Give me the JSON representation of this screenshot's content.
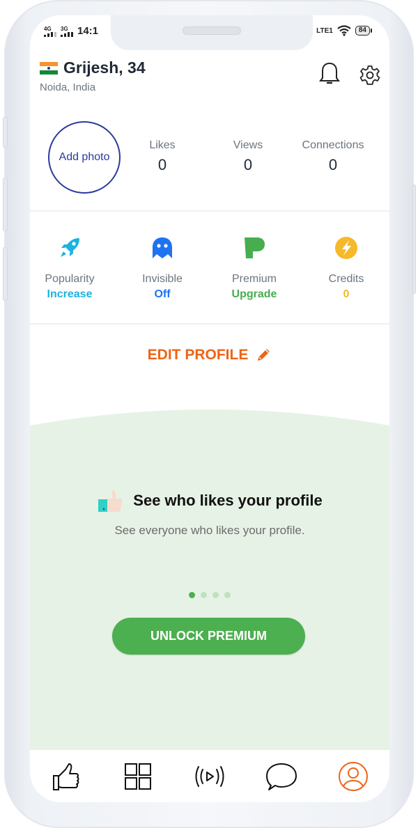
{
  "status_bar": {
    "network1": "4G",
    "network2": "3G",
    "time": "14:1",
    "volte": "LTE1",
    "battery": "84"
  },
  "profile": {
    "name": "Grijesh, 34",
    "location": "Noida, India",
    "flag_icon": "india-flag-icon"
  },
  "header_actions": {
    "notifications_icon": "bell-icon",
    "settings_icon": "gear-icon"
  },
  "stats": {
    "add_photo_label": "Add photo",
    "items": [
      {
        "label": "Likes",
        "value": "0"
      },
      {
        "label": "Views",
        "value": "0"
      },
      {
        "label": "Connections",
        "value": "0"
      }
    ]
  },
  "features": [
    {
      "label": "Popularity",
      "sub": "Increase",
      "icon": "rocket-icon",
      "color": "#1ab3e3"
    },
    {
      "label": "Invisible",
      "sub": "Off",
      "icon": "ghost-icon",
      "color": "#1d73f2"
    },
    {
      "label": "Premium",
      "sub": "Upgrade",
      "icon": "premium-p-icon",
      "color": "#47ad4f"
    },
    {
      "label": "Credits",
      "sub": "0",
      "icon": "lightning-icon",
      "color": "#f6b92b"
    }
  ],
  "edit_profile": {
    "label": "EDIT PROFILE",
    "icon": "pencil-icon",
    "color": "#ee6416"
  },
  "promo": {
    "icon": "thumbs-up-icon",
    "title": "See who likes your profile",
    "description": "See everyone who likes your profile.",
    "slides_total": 4,
    "active_slide": 1,
    "button_label": "UNLOCK PREMIUM",
    "background": "#e7f2e6",
    "button_color": "#4caf50"
  },
  "bottom_nav": {
    "items": [
      {
        "name": "likes",
        "icon": "thumbs-up-icon",
        "active": false
      },
      {
        "name": "browse",
        "icon": "grid-icon",
        "active": false
      },
      {
        "name": "live",
        "icon": "broadcast-icon",
        "active": false
      },
      {
        "name": "messages",
        "icon": "chat-bubble-icon",
        "active": false
      },
      {
        "name": "profile",
        "icon": "user-circle-icon",
        "active": true
      }
    ],
    "active_color": "#ee6416"
  }
}
